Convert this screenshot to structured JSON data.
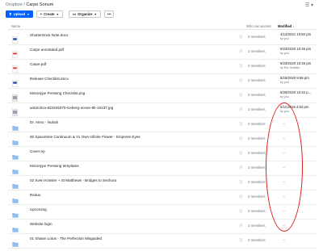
{
  "breadcrumb": {
    "root": "Dropbox",
    "sep": "/",
    "current": "Carpe Sonum"
  },
  "view_icon": "grid-view-icon",
  "toolbar": {
    "upload": "Upload",
    "create": "Create",
    "organize": "Organize",
    "more": "•••"
  },
  "columns": {
    "name": "Name",
    "access": "Who can access",
    "modified": "Modified",
    "sort_arrow": "↓"
  },
  "info_glyph": "ⓘ",
  "rows": [
    {
      "icon": "word-doc-icon",
      "name": "Shutterstock Note.docx",
      "members": "2 members",
      "modified": "4/12/2021 10:50 pm",
      "by": "by you"
    },
    {
      "icon": "pdf-file-icon",
      "name": "Carpe annotated.pdf",
      "members": "2 members",
      "modified": "9/23/2020 10:46 pm",
      "by": "by you"
    },
    {
      "icon": "pdf-file-icon",
      "name": "Carpe.pdf",
      "members": "2 members",
      "modified": "9/23/2020 10:46 pm",
      "by": "by Eric Snaider"
    },
    {
      "icon": "word-doc-icon",
      "name": "Release Checklist.docx",
      "members": "2 members",
      "modified": "8/18/2020 9:55 pm",
      "by": "by you"
    },
    {
      "icon": "image-file-icon",
      "name": "Monotype Pressing Checklist.png",
      "members": "2 members",
      "modified": "8/29/2020 10:42 p...",
      "by": "by you"
    },
    {
      "icon": "image-file-icon",
      "name": "antarctica-9342e5370-iceberg-ocean-8k-16237.jpg",
      "members": "2 members",
      "modified": "5/11/2018 4:52 pm",
      "by": "by you"
    },
    {
      "icon": "folder-icon",
      "name": "Dr. Atmo - Nubah",
      "members": "2 members",
      "modified": "--",
      "by": ""
    },
    {
      "icon": "folder-icon",
      "name": "00 Spacetime Continuum & Yo Own Infinite Flower - Empress Eyes",
      "members": "2 members",
      "modified": "--",
      "by": ""
    },
    {
      "icon": "folder-icon",
      "name": "Cover ep",
      "members": "2 members",
      "modified": "--",
      "by": ""
    },
    {
      "icon": "folder-icon",
      "name": "Monotype Pressing templates",
      "members": "2 members",
      "modified": "--",
      "by": ""
    },
    {
      "icon": "folder-icon",
      "name": "02 Sven Kössler + St Matthews - Bridges to Sechura",
      "members": "2 members",
      "modified": "--",
      "by": ""
    },
    {
      "icon": "folder-icon",
      "name": "Redux",
      "members": "2 members",
      "modified": "--",
      "by": ""
    },
    {
      "icon": "folder-icon",
      "name": "Upcoming",
      "members": "2 members",
      "modified": "--",
      "by": ""
    },
    {
      "icon": "folder-icon",
      "name": "Website login",
      "members": "2 members",
      "modified": "--",
      "by": ""
    },
    {
      "icon": "folder-icon",
      "name": "01 Shawn Lotus - The Perfection Misguided",
      "members": "2 members",
      "modified": "--",
      "by": ""
    }
  ],
  "colors": {
    "accent": "#0061fe",
    "folder": "#92bff2",
    "pdf": "#d93025",
    "word": "#2b579a",
    "annotation": "#e01b1b"
  }
}
